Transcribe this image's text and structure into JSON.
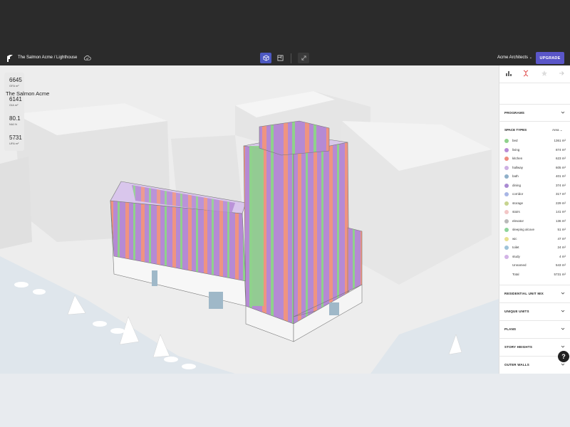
{
  "header": {
    "breadcrumb": "The Salmon Acme / Lighthouse",
    "org": "Acme Architects",
    "upgrade": "UPGRADE"
  },
  "metrics": [
    {
      "value": "6645",
      "label": "GFA m²"
    },
    {
      "value": "6141",
      "label": "GIA m²"
    },
    {
      "value": "80.1",
      "label": "NIA %"
    },
    {
      "value": "5731",
      "label": "UFA m²"
    }
  ],
  "panel": {
    "title": "The Salmon Acme",
    "sections_top": [
      "PROGRAMS"
    ],
    "space_types_header": "SPACE TYPES",
    "area_selector": "Area",
    "space_types": [
      {
        "name": "bed",
        "value": "1361 m²",
        "color": "#8fd18c"
      },
      {
        "name": "living",
        "value": "874 m²",
        "color": "#b88ad6"
      },
      {
        "name": "kitchen",
        "value": "623 m²",
        "color": "#ee8d7f"
      },
      {
        "name": "hallway",
        "value": "605 m²",
        "color": "#cdb0e3"
      },
      {
        "name": "bath",
        "value": "401 m²",
        "color": "#8fb0c9"
      },
      {
        "name": "dining",
        "value": "374 m²",
        "color": "#a98ad2"
      },
      {
        "name": "corridor",
        "value": "317 m²",
        "color": "#a8b6e6"
      },
      {
        "name": "storage",
        "value": "229 m²",
        "color": "#c7d48f"
      },
      {
        "name": "stairs",
        "value": "141 m²",
        "color": "#f2c6c6"
      },
      {
        "name": "elevator",
        "value": "136 m²",
        "color": "#b9b9b9"
      },
      {
        "name": "sleeping alcove",
        "value": "51 m²",
        "color": "#8ed49b"
      },
      {
        "name": "wic",
        "value": "47 m²",
        "color": "#e8e08f"
      },
      {
        "name": "toilet",
        "value": "24 m²",
        "color": "#9ec3d9"
      },
      {
        "name": "study",
        "value": "4 m²",
        "color": "#d2b3e6"
      },
      {
        "name": "Unnamed",
        "value": "543 m²",
        "color": ""
      },
      {
        "name": "Total",
        "value": "5731 m²",
        "color": ""
      }
    ],
    "sections_bottom": [
      "RESIDENTIAL UNIT MIX",
      "UNIQUE UNITS",
      "PLANS",
      "STORY HEIGHTS",
      "OUTER WALLS"
    ],
    "help": "?"
  }
}
